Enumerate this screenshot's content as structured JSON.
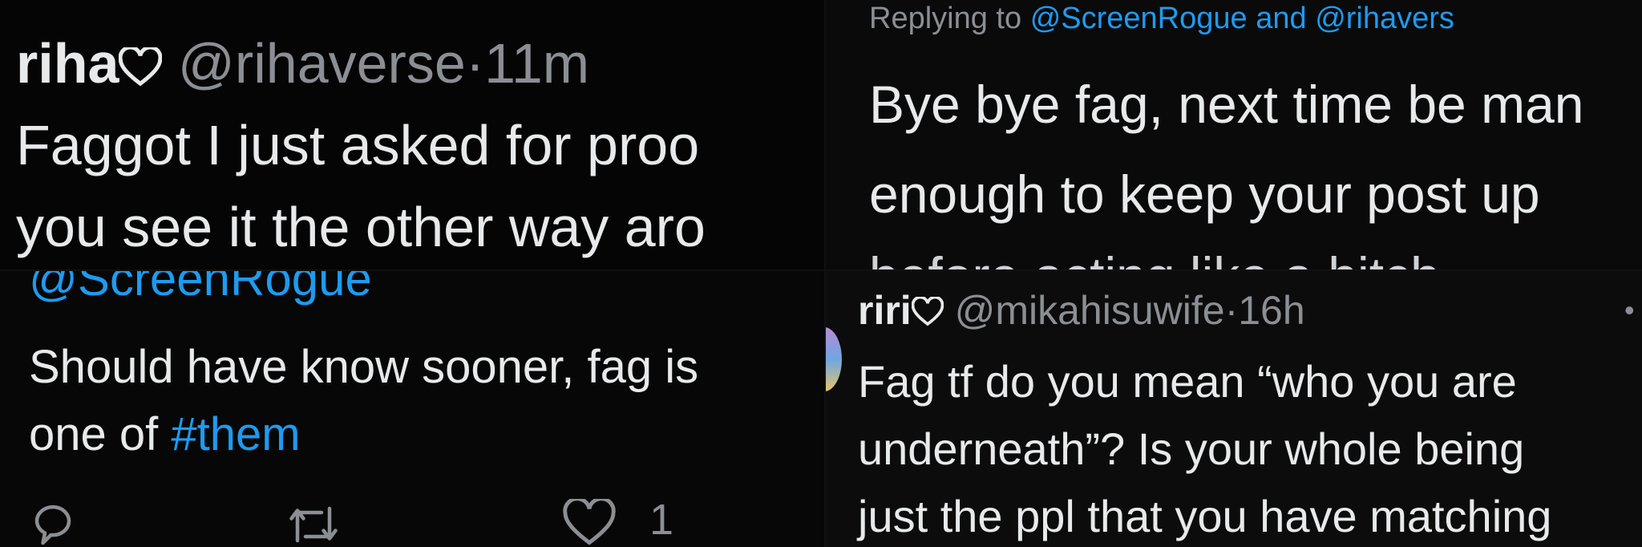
{
  "panel1": {
    "name": "riha",
    "handle": "@rihaverse",
    "separator": "·",
    "time": "11m",
    "line1": "Faggot I just asked for proo",
    "line2": "you see it the other way aro"
  },
  "panel2": {
    "reply_prefix": "Replying to",
    "reply_mention1": "@ScreenRogue",
    "reply_and": "and",
    "reply_mention2": "@rihavers",
    "line1": "Bye bye fag, next time be man",
    "line2": "enough to keep your post up",
    "line3": "before acting like a bitch"
  },
  "panel3": {
    "mention": "@ScreenRogue",
    "line1": "Should have know sooner, fag is",
    "line2_prefix": "one of",
    "hashtag": "#them",
    "like_count": "1",
    "icons": [
      "reply-icon",
      "retweet-icon",
      "like-icon"
    ]
  },
  "panel4": {
    "name": "riri",
    "handle": "@mikahisuwife",
    "separator": "·",
    "time": "16h",
    "more": "•",
    "line1": "Fag tf do you mean “who you are",
    "line2": "underneath”? Is your whole being",
    "line3": "just the ppl that you have matching"
  },
  "colors": {
    "background": "#000000",
    "text": "#e7e9ea",
    "muted": "#8b8f94",
    "link": "#1d9bf0"
  }
}
